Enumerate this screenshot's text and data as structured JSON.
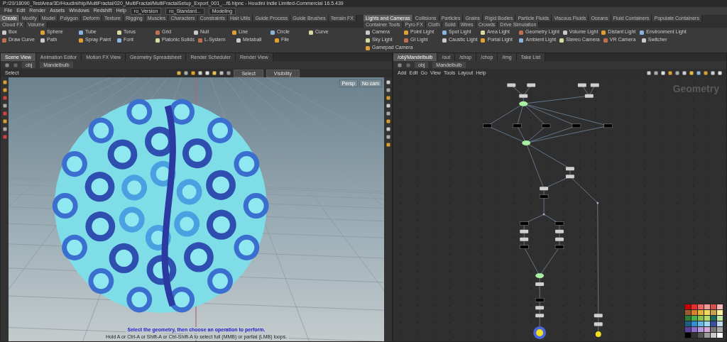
{
  "window": {
    "title": "P:/20/18090_TestArea/3D/Houdini/hip/MultiFractal/020_MultiFractal/MultiFractalSetup_Export_001_...f6.hipnc - Houdini Indie Limited-Commercial 16.5.439"
  },
  "menu": [
    "File",
    "Edit",
    "Render",
    "Assets",
    "Windows",
    "Redshift",
    "Help"
  ],
  "desktop_fields": [
    "ro_Version",
    "ro_Standard...",
    "Modeling"
  ],
  "shelf_left": {
    "tabs": [
      {
        "label": "Create",
        "selected": true
      },
      {
        "label": "Modify",
        "selected": false
      },
      {
        "label": "Model",
        "selected": false
      },
      {
        "label": "Polygon",
        "selected": false
      },
      {
        "label": "Deform",
        "selected": false
      },
      {
        "label": "Texture",
        "selected": false
      },
      {
        "label": "Rigging",
        "selected": false
      },
      {
        "label": "Muscles",
        "selected": false
      },
      {
        "label": "Characters",
        "selected": false
      },
      {
        "label": "Constraints",
        "selected": false
      },
      {
        "label": "Hair Utils",
        "selected": false
      },
      {
        "label": "Guide Process",
        "selected": false
      },
      {
        "label": "Guide Brushes",
        "selected": false
      },
      {
        "label": "Terrain FX",
        "selected": false
      },
      {
        "label": "Cloud FX",
        "selected": false
      },
      {
        "label": "Volume",
        "selected": false
      }
    ],
    "tools": [
      "Box",
      "Sphere",
      "Tube",
      "Torus",
      "Grid",
      "Null",
      "Line",
      "Circle",
      "Curve",
      "Draw Curve",
      "Path",
      "Spray Paint",
      "Font",
      "Platonic Solids",
      "L-System",
      "Metaball",
      "File"
    ]
  },
  "shelf_right": {
    "tabs": [
      {
        "label": "Lights and Cameras",
        "selected": true
      },
      {
        "label": "Collisions",
        "selected": false
      },
      {
        "label": "Particles",
        "selected": false
      },
      {
        "label": "Grains",
        "selected": false
      },
      {
        "label": "Rigid Bodies",
        "selected": false
      },
      {
        "label": "Particle Fluids",
        "selected": false
      },
      {
        "label": "Viscous Fluids",
        "selected": false
      },
      {
        "label": "Oceans",
        "selected": false
      },
      {
        "label": "Fluid Containers",
        "selected": false
      },
      {
        "label": "Populate Containers",
        "selected": false
      },
      {
        "label": "Container Tools",
        "selected": false
      },
      {
        "label": "Pyro FX",
        "selected": false
      },
      {
        "label": "Cloth",
        "selected": false
      },
      {
        "label": "Solid",
        "selected": false
      },
      {
        "label": "Wires",
        "selected": false
      },
      {
        "label": "Crowds",
        "selected": false
      },
      {
        "label": "Drive Simulation",
        "selected": false
      }
    ],
    "tools": [
      "Camera",
      "Point Light",
      "Spot Light",
      "Area Light",
      "Geometry Light",
      "Volume Light",
      "Distant Light",
      "Environment Light",
      "Sky Light",
      "GI Light",
      "Caustic Light",
      "Portal Light",
      "Ambient Light",
      "Stereo Camera",
      "VR Camera",
      "Switcher",
      "Gamepad Camera"
    ]
  },
  "scene_pane": {
    "tabs": [
      {
        "label": "Scene View",
        "selected": true
      },
      {
        "label": "Animation Editor",
        "selected": false
      },
      {
        "label": "Motion FX View",
        "selected": false
      },
      {
        "label": "Geometry Spreadsheet",
        "selected": false
      },
      {
        "label": "Render Scheduler",
        "selected": false
      },
      {
        "label": "Render View",
        "selected": false
      }
    ],
    "path": [
      "obj",
      "Mandelbulb"
    ],
    "tool": "Select",
    "dropdowns": [
      "Select",
      "Visibility"
    ],
    "camera_buttons": [
      "Persp",
      "No cam"
    ],
    "prompt": "Select the geometry, then choose an operation to perform.",
    "hint": "Hold A or Ctrl-A or Shift-A or Ctrl-Shift-A to select full (MMB) or partial (LMB) loops."
  },
  "network_pane": {
    "tabs": [
      {
        "label": "/obj/Mandelbulb",
        "selected": true
      },
      {
        "label": "/out",
        "selected": false
      },
      {
        "label": "/shop",
        "selected": false
      },
      {
        "label": "/chop",
        "selected": false
      },
      {
        "label": "/img",
        "selected": false
      },
      {
        "label": "Take List",
        "selected": false
      }
    ],
    "path": [
      "obj",
      "Mandelbulb"
    ],
    "menu": [
      "Add",
      "Edit",
      "Go",
      "View",
      "Tools",
      "Layout",
      "Help"
    ],
    "context_label": "Geometry",
    "palette": [
      {
        "color": "#cc0000"
      },
      {
        "color": "#e52e2e"
      },
      {
        "color": "#f06666"
      },
      {
        "color": "#f59a9a"
      },
      {
        "color": "#d94f4f"
      },
      {
        "color": "#f2b8b8"
      },
      {
        "color": "#a05a2c"
      },
      {
        "color": "#d9822b"
      },
      {
        "color": "#e5b533"
      },
      {
        "color": "#f2dc5e"
      },
      {
        "color": "#c8a050"
      },
      {
        "color": "#fff2a0"
      },
      {
        "color": "#2e7d32"
      },
      {
        "color": "#4caf50"
      },
      {
        "color": "#8bc34a"
      },
      {
        "color": "#b5d96b"
      },
      {
        "color": "#1b6b5a"
      },
      {
        "color": "#c5e6a0"
      },
      {
        "color": "#1d5f8a"
      },
      {
        "color": "#2f8fd6"
      },
      {
        "color": "#5fb8e6"
      },
      {
        "color": "#9fd6f0"
      },
      {
        "color": "#3a4fa0"
      },
      {
        "color": "#c0d8f0"
      },
      {
        "color": "#5b3f99"
      },
      {
        "color": "#8a6cc9"
      },
      {
        "color": "#b79be0"
      },
      {
        "color": "#d9a6d9"
      },
      {
        "color": "#777777"
      },
      {
        "color": "#aaaaaa"
      },
      {
        "color": "#000000"
      },
      {
        "color": "#333333"
      },
      {
        "color": "#555555"
      },
      {
        "color": "#999999"
      },
      {
        "color": "#cccccc"
      },
      {
        "color": "#ffffff"
      }
    ]
  }
}
